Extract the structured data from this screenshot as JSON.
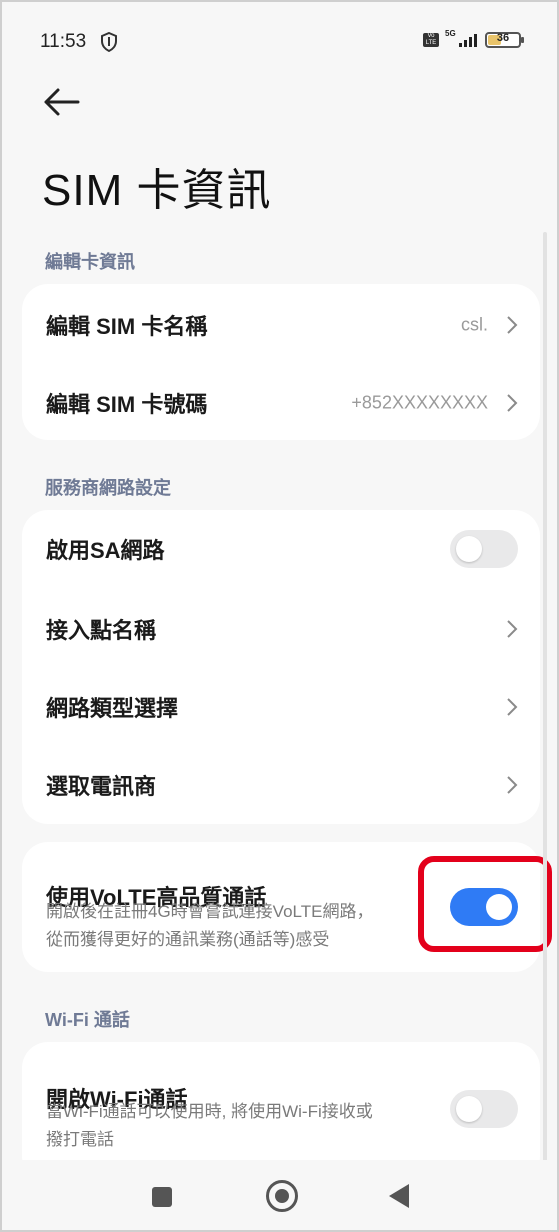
{
  "status_bar": {
    "time": "11:53",
    "volte_badge": "Vo LTE",
    "network": "5G",
    "battery_level": "36",
    "battery_color": "#e9c46a"
  },
  "page": {
    "title": "SIM 卡資訊"
  },
  "sections": {
    "card_info": {
      "header": "編輯卡資訊",
      "rows": [
        {
          "label": "編輯 SIM 卡名稱",
          "value": "csl."
        },
        {
          "label": "編輯 SIM 卡號碼",
          "value": "+852XXXXXXXX"
        }
      ]
    },
    "carrier": {
      "header": "服務商網路設定",
      "sa_label": "啟用SA網路",
      "sa_enabled": false,
      "apn_label": "接入點名稱",
      "network_type_label": "網路類型選擇",
      "operator_label": "選取電訊商"
    },
    "volte": {
      "label": "使用VoLTE高品質通話",
      "desc_line1": "開啟後在註冊4G時會嘗試連接VoLTE網路，",
      "desc_line2": "從而獲得更好的通訊業務(通話等)感受",
      "enabled": true,
      "accent_color": "#2f7bf5"
    },
    "wifi": {
      "header": "Wi-Fi 通話",
      "label": "開啟Wi-Fi通話",
      "desc_line1": "當Wi-Fi通話可以使用時, 將使用Wi-Fi接收或",
      "desc_line2": "撥打電話",
      "enabled": false
    }
  },
  "icons": {
    "back": "arrow-left-icon",
    "chevron": "chevron-right-icon",
    "shield": "shield-icon",
    "nav_recents": "square-icon",
    "nav_home": "circle-icon",
    "nav_back": "triangle-left-icon"
  },
  "annotation": {
    "highlight_color": "#e3001b"
  }
}
